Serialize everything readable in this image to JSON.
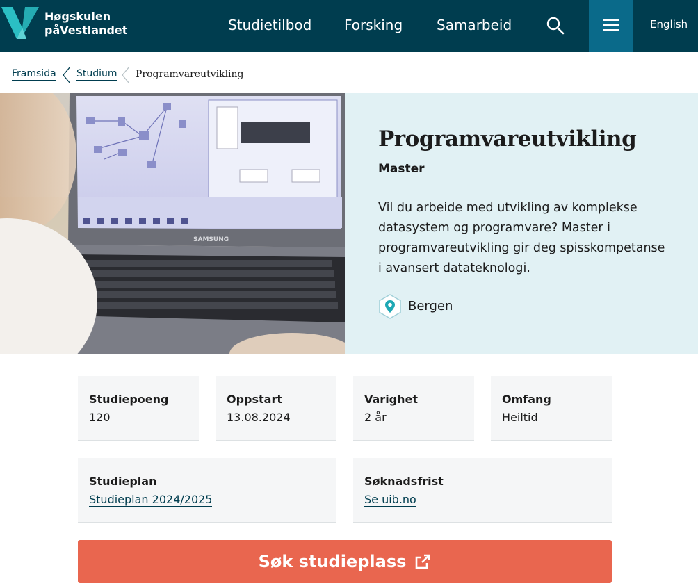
{
  "header": {
    "logo_line1": "Høgskulen",
    "logo_line2": "påVestlandet",
    "nav": [
      "Studietilbod",
      "Forsking",
      "Samarbeid"
    ],
    "language": "English",
    "colors": {
      "background": "#003d4f",
      "menu_active": "#0a6a8a",
      "logo_accent": "#2bbfc4"
    },
    "icons": {
      "search": "search-icon",
      "menu": "hamburger-icon"
    }
  },
  "breadcrumb": {
    "items": [
      "Framsida",
      "Studium"
    ],
    "current": "Programvareutvikling"
  },
  "hero": {
    "title": "Programvareutvikling",
    "degree": "Master",
    "description": "Vil du arbeide med utvikling av komplekse datasystem og programvare? Master i programvareutvikling gir deg spisskompetanse i avansert datateknologi.",
    "location": "Bergen",
    "image": "laptop-network-diagram-photo",
    "panel_color": "#e1f1f4"
  },
  "facts": [
    {
      "label": "Studiepoeng",
      "value": "120"
    },
    {
      "label": "Oppstart",
      "value": "13.08.2024"
    },
    {
      "label": "Varighet",
      "value": "2 år"
    },
    {
      "label": "Omfang",
      "value": "Heiltid"
    }
  ],
  "links": [
    {
      "label": "Studieplan",
      "value": "Studieplan 2024/2025"
    },
    {
      "label": "Søknadsfrist",
      "value": "Se uib.no"
    }
  ],
  "cta": {
    "label": "Søk studieplass",
    "icon": "external-link-icon",
    "color": "#e9664f"
  }
}
